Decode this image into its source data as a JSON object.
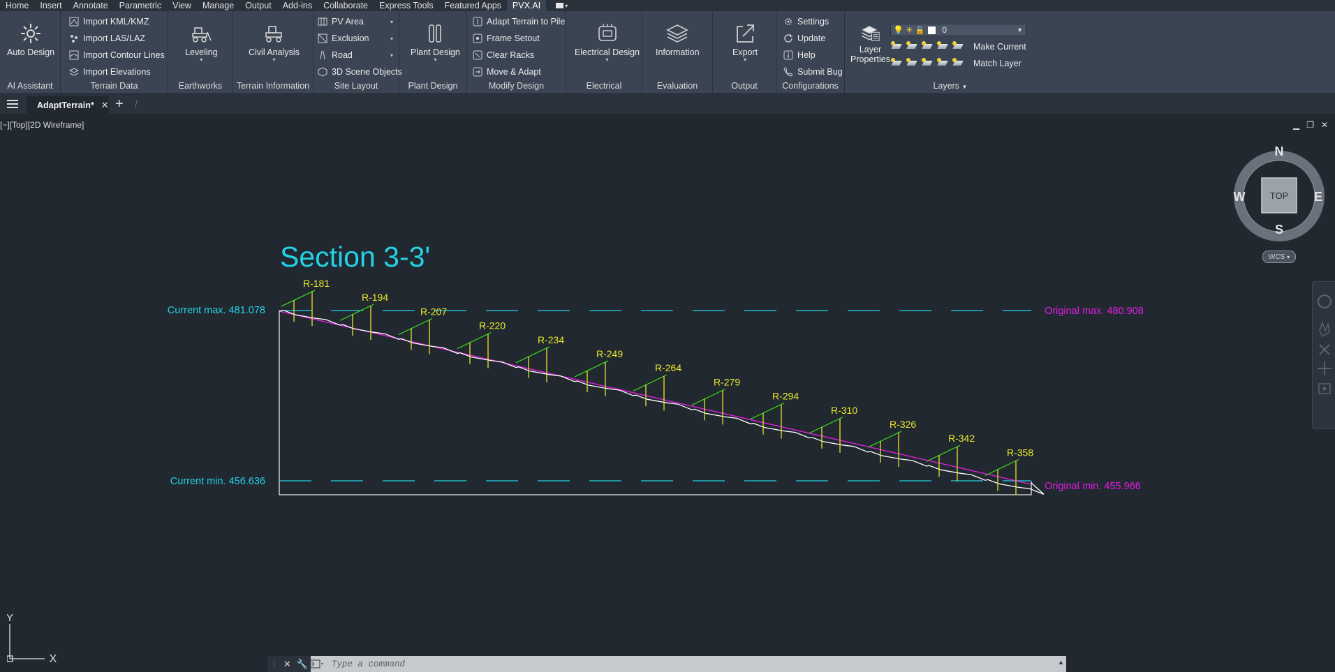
{
  "menubar": {
    "tabs": [
      "Home",
      "Insert",
      "Annotate",
      "Parametric",
      "View",
      "Manage",
      "Output",
      "Add-ins",
      "Collaborate",
      "Express Tools",
      "Featured Apps",
      "PVX.AI"
    ],
    "active_tab": "PVX.AI"
  },
  "ribbon": {
    "ai_assistant": {
      "title": "AI Assistant",
      "auto_design": "Auto Design"
    },
    "terrain_data": {
      "title": "Terrain Data",
      "items": [
        "Import KML/KMZ",
        "Import LAS/LAZ",
        "Import Contour Lines",
        "Import Elevations"
      ]
    },
    "earthworks": {
      "title": "Earthworks",
      "leveling": "Leveling"
    },
    "terrain_information": {
      "title": "Terrain Information",
      "civil_analysis": "Civil Analysis"
    },
    "site_layout": {
      "title": "Site Layout",
      "items": [
        "PV Area",
        "Exclusion",
        "Road",
        "3D Scene Objects"
      ]
    },
    "plant_design": {
      "title": "Plant Design",
      "button": "Plant Design"
    },
    "modify_design": {
      "title": "Modify Design",
      "items": [
        "Adapt Terrain to Pile",
        "Frame Setout",
        "Clear Racks",
        "Move & Adapt"
      ]
    },
    "electrical": {
      "title": "Electrical",
      "button": "Electrical Design"
    },
    "evaluation": {
      "title": "Evaluation",
      "button": "Information"
    },
    "output": {
      "title": "Output",
      "button": "Export"
    },
    "configurations": {
      "title": "Configurations",
      "items": [
        "Settings",
        "Update",
        "Help",
        "Submit Bug"
      ]
    },
    "layers": {
      "title": "Layers",
      "layer_properties_line1": "Layer",
      "layer_properties_line2": "Properties",
      "current_layer": "0",
      "make_current": "Make Current",
      "match_layer": "Match Layer"
    }
  },
  "filetabs": {
    "active_doc": "AdaptTerrain*",
    "close": "✕",
    "new": "+"
  },
  "viewport": {
    "label": "[−][Top][2D Wireframe]",
    "controls": [
      "▁",
      "❐",
      "✕"
    ],
    "viewcube": {
      "n": "N",
      "s": "S",
      "e": "E",
      "w": "W",
      "face": "TOP",
      "wcs": "WCS"
    },
    "ucs": {
      "x": "X",
      "y": "Y"
    }
  },
  "drawing": {
    "title": "Section 3-3'",
    "current_max": "Current max. 481.078",
    "current_min": "Current min. 456.636",
    "original_max": "Original max. 480.908",
    "original_min": "Original min. 455.966",
    "rows": [
      "R-181",
      "R-194",
      "R-207",
      "R-220",
      "R-234",
      "R-249",
      "R-264",
      "R-279",
      "R-294",
      "R-310",
      "R-326",
      "R-342",
      "R-358"
    ],
    "colors": {
      "title": "#22d3e6",
      "current": "#22d3e6",
      "original": "#e21ee0",
      "row_labels": "#eaea2a",
      "racks": "#3ad11c",
      "piles": "#e6e62a",
      "terrain": "#ffffff"
    }
  },
  "command": {
    "placeholder": "Type a command"
  }
}
